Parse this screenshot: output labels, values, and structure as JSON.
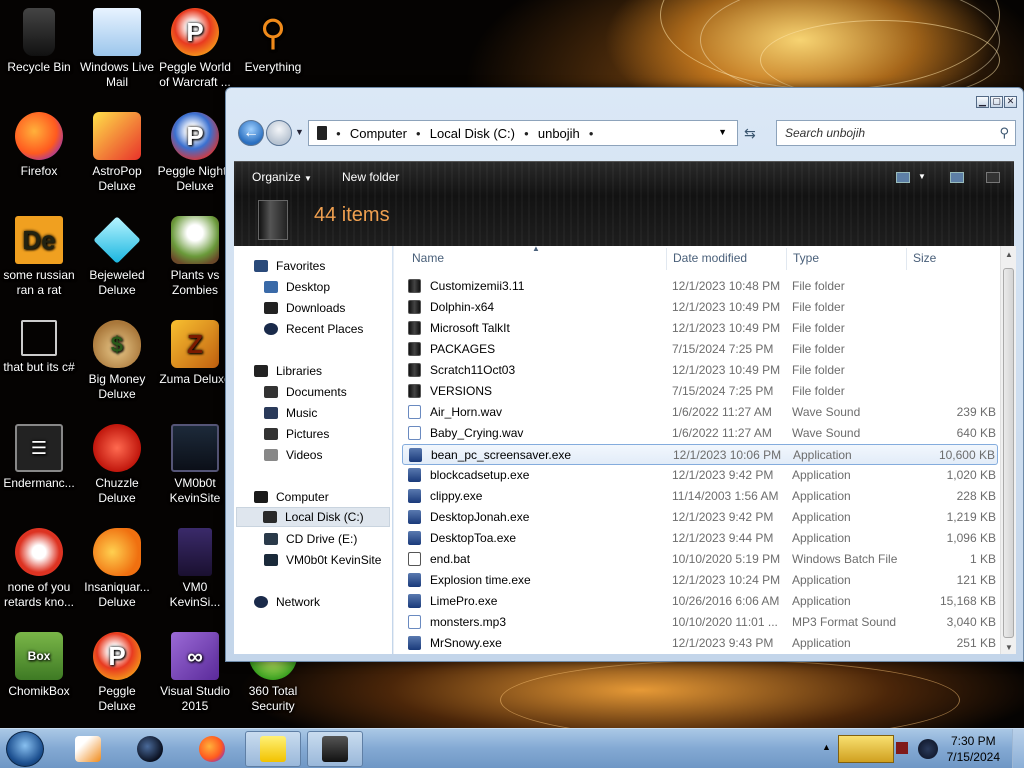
{
  "desktop": {
    "icons": [
      {
        "label": "Recycle Bin",
        "icon": "recycle-bin-icon"
      },
      {
        "label": "Windows Live Mail",
        "icon": "mail-icon"
      },
      {
        "label": "Peggle World of Warcraft ...",
        "icon": "peggle-icon"
      },
      {
        "label": "Everything",
        "icon": "search-icon"
      },
      {
        "label": "Firefox",
        "icon": "firefox-icon"
      },
      {
        "label": "AstroPop Deluxe",
        "icon": "astropop-icon"
      },
      {
        "label": "Peggle Nights Deluxe",
        "icon": "peggle-icon"
      },
      {
        "label": "some russian ran a rat",
        "icon": "de-icon"
      },
      {
        "label": "Bejeweled Deluxe",
        "icon": "gem-icon"
      },
      {
        "label": "Plants vs Zombies",
        "icon": "plant-icon"
      },
      {
        "label": "that but its c#",
        "icon": "window-stack-icon"
      },
      {
        "label": "Big Money Deluxe",
        "icon": "money-bag-icon"
      },
      {
        "label": "Zuma Deluxe",
        "icon": "zuma-icon"
      },
      {
        "label": "Endermanc...",
        "icon": "terminal-icon"
      },
      {
        "label": "Chuzzle Deluxe",
        "icon": "chuzzle-icon"
      },
      {
        "label": "VM0b0t KevinSite",
        "icon": "vm-icon"
      },
      {
        "label": "none of you retards kno...",
        "icon": "app-icon"
      },
      {
        "label": "Insaniquar... Deluxe",
        "icon": "fish-icon"
      },
      {
        "label": "VM0 KevinSi...",
        "icon": "firefox-doc-icon"
      },
      {
        "label": "ChomikBox",
        "icon": "chomikbox-icon"
      },
      {
        "label": "Peggle Deluxe",
        "icon": "peggle-icon"
      },
      {
        "label": "Visual Studio 2015",
        "icon": "visual-studio-icon"
      },
      {
        "label": "360 Total Security",
        "icon": "security-icon"
      }
    ]
  },
  "explorer": {
    "address": {
      "crumbs": [
        "Computer",
        "Local Disk (C:)",
        "unbojih"
      ]
    },
    "search": {
      "placeholder": "Search unbojih"
    },
    "commands": {
      "organize": "Organize",
      "new_folder": "New folder"
    },
    "items_count": "44 items",
    "nav": {
      "favorites": "Favorites",
      "desktop": "Desktop",
      "downloads": "Downloads",
      "recent": "Recent Places",
      "libraries": "Libraries",
      "documents": "Documents",
      "music": "Music",
      "pictures": "Pictures",
      "videos": "Videos",
      "computer": "Computer",
      "local_disk": "Local Disk (C:)",
      "cd_drive": "CD Drive (E:)",
      "vm_site": "VM0b0t KevinSite",
      "network": "Network"
    },
    "columns": {
      "name": "Name",
      "date": "Date modified",
      "type": "Type",
      "size": "Size"
    },
    "files": [
      {
        "name": "Customizemii3.11",
        "date": "12/1/2023 10:48 PM",
        "type": "File folder",
        "size": "",
        "kind": "folder"
      },
      {
        "name": "Dolphin-x64",
        "date": "12/1/2023 10:49 PM",
        "type": "File folder",
        "size": "",
        "kind": "folder"
      },
      {
        "name": "Microsoft TalkIt",
        "date": "12/1/2023 10:49 PM",
        "type": "File folder",
        "size": "",
        "kind": "folder"
      },
      {
        "name": "PACKAGES",
        "date": "7/15/2024 7:25 PM",
        "type": "File folder",
        "size": "",
        "kind": "folder"
      },
      {
        "name": "Scratch11Oct03",
        "date": "12/1/2023 10:49 PM",
        "type": "File folder",
        "size": "",
        "kind": "folder"
      },
      {
        "name": "VERSIONS",
        "date": "7/15/2024 7:25 PM",
        "type": "File folder",
        "size": "",
        "kind": "folder"
      },
      {
        "name": "Air_Horn.wav",
        "date": "1/6/2022 11:27 AM",
        "type": "Wave Sound",
        "size": "239 KB",
        "kind": "audio"
      },
      {
        "name": "Baby_Crying.wav",
        "date": "1/6/2022 11:27 AM",
        "type": "Wave Sound",
        "size": "640 KB",
        "kind": "audio"
      },
      {
        "name": "bean_pc_screensaver.exe",
        "date": "12/1/2023 10:06 PM",
        "type": "Application",
        "size": "10,600 KB",
        "kind": "app",
        "selected": true
      },
      {
        "name": "blockcadsetup.exe",
        "date": "12/1/2023 9:42 PM",
        "type": "Application",
        "size": "1,020 KB",
        "kind": "app"
      },
      {
        "name": "clippy.exe",
        "date": "11/14/2003 1:56 AM",
        "type": "Application",
        "size": "228 KB",
        "kind": "app"
      },
      {
        "name": "DesktopJonah.exe",
        "date": "12/1/2023 9:42 PM",
        "type": "Application",
        "size": "1,219 KB",
        "kind": "app"
      },
      {
        "name": "DesktopToa.exe",
        "date": "12/1/2023 9:44 PM",
        "type": "Application",
        "size": "1,096 KB",
        "kind": "app"
      },
      {
        "name": "end.bat",
        "date": "10/10/2020 5:19 PM",
        "type": "Windows Batch File",
        "size": "1 KB",
        "kind": "batch"
      },
      {
        "name": "Explosion time.exe",
        "date": "12/1/2023 10:24 PM",
        "type": "Application",
        "size": "121 KB",
        "kind": "app"
      },
      {
        "name": "LimePro.exe",
        "date": "10/26/2016 6:06 AM",
        "type": "Application",
        "size": "15,168 KB",
        "kind": "app"
      },
      {
        "name": "monsters.mp3",
        "date": "10/10/2020 11:01 ...",
        "type": "MP3 Format Sound",
        "size": "3,040 KB",
        "kind": "audio"
      },
      {
        "name": "MrSnowy.exe",
        "date": "12/1/2023 9:43 PM",
        "type": "Application",
        "size": "251 KB",
        "kind": "app"
      }
    ]
  },
  "taskbar": {
    "time": "7:30 PM",
    "date": "7/15/2024"
  },
  "colors": {
    "accent": "#f0a050",
    "selection_border": "#84acdd",
    "taskbar": "#83a9d3"
  }
}
